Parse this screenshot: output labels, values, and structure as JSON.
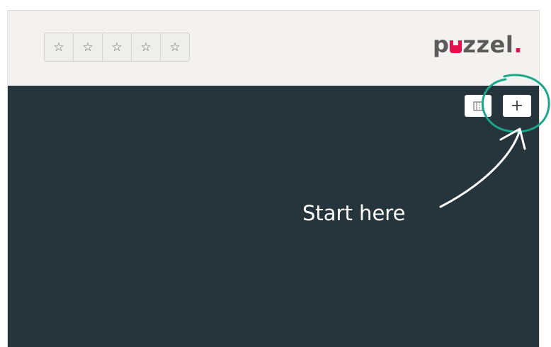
{
  "rating": {
    "stars": [
      "☆",
      "☆",
      "☆",
      "☆",
      "☆"
    ]
  },
  "logo": {
    "text_before": "p",
    "text_after": "zzel",
    "dot": ".",
    "brand_color": "#e5114f"
  },
  "toolbar": {
    "columns_icon": "columns-icon",
    "add_label": "+"
  },
  "annotation": {
    "text": "Start here",
    "highlight_color": "#1ba78a"
  },
  "colors": {
    "header_bg": "#f3f2f0",
    "panel_bg": "#26343b"
  }
}
